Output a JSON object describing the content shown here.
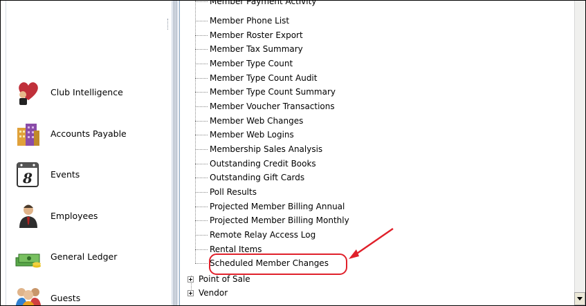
{
  "nav": {
    "items": [
      {
        "label": "Club Intelligence",
        "icon": "heart-person-icon"
      },
      {
        "label": "Accounts Payable",
        "icon": "building-icon"
      },
      {
        "label": "Events",
        "icon": "calendar-icon"
      },
      {
        "label": "Employees",
        "icon": "person-tie-icon"
      },
      {
        "label": "General Ledger",
        "icon": "money-stack-icon"
      },
      {
        "label": "Guests",
        "icon": "people-group-icon"
      }
    ]
  },
  "tree": {
    "partial_top": "Member Payment Activity",
    "children": [
      "Member Phone List",
      "Member Roster Export",
      "Member Tax Summary",
      "Member Type Count",
      "Member Type Count Audit",
      "Member Type Count Summary",
      "Member Voucher Transactions",
      "Member Web Changes",
      "Member Web Logins",
      "Membership Sales Analysis",
      "Outstanding Credit Books",
      "Outstanding Gift Cards",
      "Poll Results",
      "Projected Member Billing Annual",
      "Projected Member Billing Monthly",
      "Remote Relay Access Log",
      "Rental Items",
      "Scheduled Member Changes"
    ],
    "roots": [
      "Point of Sale",
      "Vendor"
    ]
  },
  "colors": {
    "annotation": "#e0202a",
    "splitter": "#dde3ec"
  }
}
